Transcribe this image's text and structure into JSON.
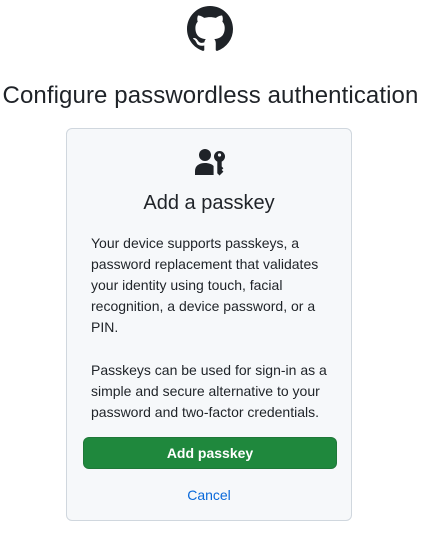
{
  "header": {
    "logo_icon": "github-mark-icon"
  },
  "page_title": "Configure passwordless authentication",
  "card": {
    "icon": "passkey-icon",
    "title": "Add a passkey",
    "paragraph_1": "Your device supports passkeys, a password replacement that validates your identity using touch, facial recognition, a device password, or a PIN.",
    "paragraph_2": "Passkeys can be used for sign-in as a simple and secure alternative to your password and two-factor credentials.",
    "primary_button_label": "Add passkey",
    "cancel_label": "Cancel"
  },
  "colors": {
    "primary_button": "#1f883d",
    "link": "#0969da",
    "card_background": "#f6f8fa",
    "card_border": "#d0d7de",
    "text": "#1f2328"
  }
}
